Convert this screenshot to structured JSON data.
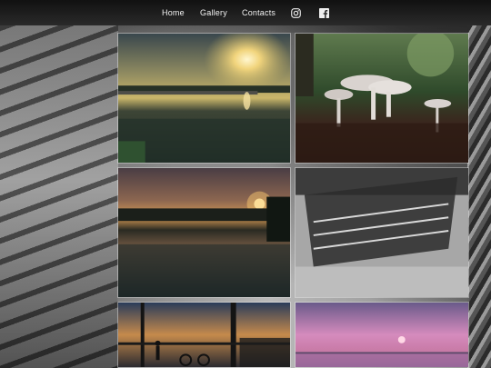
{
  "nav": {
    "items": [
      {
        "label": "Home"
      },
      {
        "label": "Gallery"
      },
      {
        "label": "Contacts"
      }
    ],
    "social": [
      {
        "icon": "instagram-icon"
      },
      {
        "icon": "facebook-icon"
      }
    ]
  },
  "gallery": {
    "photos": [
      {
        "subject": "sunset-over-lake-with-pier"
      },
      {
        "subject": "white-mushrooms-on-forest-floor"
      },
      {
        "subject": "orange-sunset-over-calm-lake"
      },
      {
        "subject": "grayscale-pier-reflection"
      },
      {
        "subject": "silhouette-on-pier-at-dusk"
      },
      {
        "subject": "pink-sunset-over-sea"
      }
    ]
  },
  "colors": {
    "nav_bg": "#1b1b1b",
    "nav_text": "#f2f2f2"
  }
}
